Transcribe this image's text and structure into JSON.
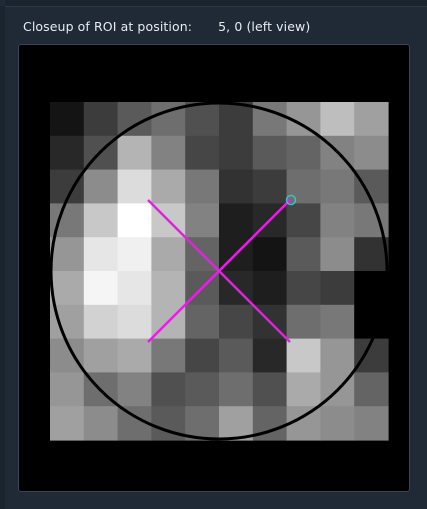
{
  "header": {
    "label": "Closeup of ROI at position:",
    "position": "5, 0 (left view)"
  },
  "closeup": {
    "grid_cols": 10,
    "grid_rows": 10,
    "pixel_values": [
      [
        20,
        60,
        90,
        110,
        80,
        60,
        120,
        150,
        190,
        160
      ],
      [
        40,
        80,
        180,
        130,
        70,
        60,
        90,
        100,
        130,
        140
      ],
      [
        60,
        140,
        220,
        170,
        120,
        50,
        60,
        110,
        120,
        90
      ],
      [
        120,
        200,
        255,
        200,
        130,
        30,
        40,
        70,
        130,
        120
      ],
      [
        150,
        230,
        240,
        170,
        100,
        30,
        20,
        90,
        140,
        50
      ],
      [
        170,
        245,
        230,
        180,
        90,
        40,
        30,
        70,
        60,
        0
      ],
      [
        160,
        210,
        220,
        180,
        100,
        70,
        50,
        110,
        120,
        0
      ],
      [
        140,
        160,
        170,
        120,
        70,
        90,
        40,
        200,
        150,
        60
      ],
      [
        150,
        110,
        130,
        80,
        90,
        110,
        80,
        170,
        150,
        100
      ],
      [
        160,
        140,
        110,
        90,
        110,
        160,
        100,
        150,
        140,
        130
      ]
    ],
    "circle_color": "#000000",
    "cross_color": "#e61ee6",
    "marker_color": "#37c3c8"
  }
}
